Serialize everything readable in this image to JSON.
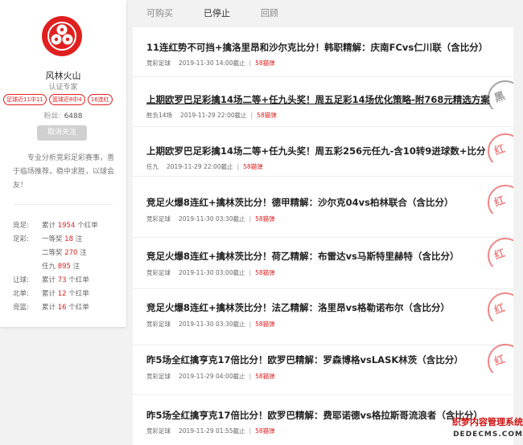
{
  "expert": {
    "name": "风林火山",
    "role": "认证专家",
    "tags": [
      "足球近11中11",
      "篮球近8中4",
      "16连红"
    ],
    "fans_label": "粉丝:",
    "fans_value": "6488",
    "unfollow_label": "取消关注",
    "bio": "专业分析竞彩足彩赛事，善于临场推荐，稳中求胜，以球会友！"
  },
  "stats": [
    {
      "key": "竞足:",
      "prefix": "累计",
      "num": "1954",
      "suffix": "个红单"
    },
    {
      "key": "足彩:",
      "prefix": "一等奖",
      "num": "18",
      "suffix": "注"
    },
    {
      "key": "",
      "prefix": "二等奖",
      "num": "270",
      "suffix": "注"
    },
    {
      "key": "",
      "prefix": "任九",
      "num": "895",
      "suffix": "注"
    },
    {
      "key": "让球:",
      "prefix": "累计",
      "num": "73",
      "suffix": "个红单"
    },
    {
      "key": "北单:",
      "prefix": "累计",
      "num": "12",
      "suffix": "个红单"
    },
    {
      "key": "竞篮:",
      "prefix": "累计",
      "num": "16",
      "suffix": "个红单"
    }
  ],
  "tabs": [
    "可购买",
    "已停止",
    "回顾"
  ],
  "active_tab": "已停止",
  "meta_sep": "|",
  "items": [
    {
      "title": "11连红势不可挡+擒洛里昂和沙尔克比分！韩职精解：庆南FCvs仁川联（含比分）",
      "category": "竞彩足球",
      "deadline": "2019-11-30 14:00截止",
      "price": "58猫弹",
      "stamp": ""
    },
    {
      "title": "上期欧罗巴足彩擒14场二等+任九头奖！周五足彩14场优化策略-附768元精选方案",
      "category": "胜负14场",
      "deadline": "2019-11-29 22:00截止",
      "price": "58猫弹",
      "stamp": "黑"
    },
    {
      "title": "上期欧罗巴足彩擒14场二等+任九头奖！周五彩256元任九-含10转9进球数+比分",
      "category": "任九",
      "deadline": "2019-11-29 22:00截止",
      "price": "58猫弹",
      "stamp": "红"
    },
    {
      "title": "竞足火爆8连红+擒林茨比分！德甲精解：沙尔克04vs柏林联合（含比分）",
      "category": "竞彩足球",
      "deadline": "2019-11-30 03:30截止",
      "price": "58猫弹",
      "stamp": "红"
    },
    {
      "title": "竞足火爆8连红+擒林茨比分！荷乙精解：布雷达vs马斯特里赫特（含比分）",
      "category": "竞彩足球",
      "deadline": "2019-11-30 03:00截止",
      "price": "58猫弹",
      "stamp": "红"
    },
    {
      "title": "竞足火爆8连红+擒林茨比分！法乙精解：洛里昂vs格勒诺布尔（含比分）",
      "category": "竞彩足球",
      "deadline": "2019-11-30 03:30截止",
      "price": "58猫弹",
      "stamp": "红"
    },
    {
      "title": "昨5场全红擒亨克17倍比分！欧罗巴精解：罗森博格vsLASK林茨（含比分）",
      "category": "竞彩足球",
      "deadline": "2019-11-29 04:00截止",
      "price": "58猫弹",
      "stamp": "红"
    },
    {
      "title": "昨5场全红擒亨克17倍比分！欧罗巴精解：费耶诺德vs格拉斯哥流浪者（含比分）",
      "category": "竞彩足球",
      "deadline": "2019-11-29 01:55截止",
      "price": "58猫弹",
      "stamp": ""
    }
  ],
  "watermark": {
    "line1": "织梦内容管理系统",
    "line2": "DEDECMS.COM"
  },
  "colors": {
    "accent": "#e02020",
    "background": "#f2f2f2"
  }
}
